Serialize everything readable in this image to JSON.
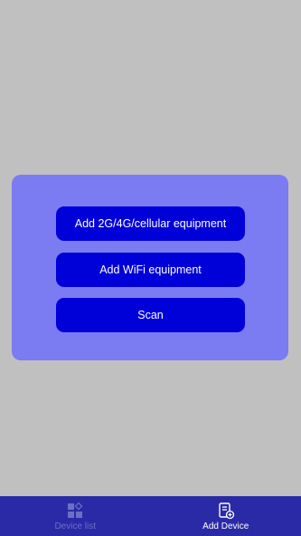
{
  "dialog": {
    "buttons": [
      {
        "label": "Add 2G/4G/cellular equipment"
      },
      {
        "label": "Add WiFi equipment"
      },
      {
        "label": "Scan"
      }
    ]
  },
  "tabbar": {
    "tabs": [
      {
        "label": "Device list",
        "icon": "grid-icon",
        "active": false
      },
      {
        "label": "Add Device",
        "icon": "add-device-icon",
        "active": true
      }
    ]
  },
  "colors": {
    "background": "#c0c0c0",
    "dialog": "#7b7bf2",
    "button": "#0000d8",
    "tabbar": "#2a2aa6",
    "tab_inactive": "#6e6ec4",
    "tab_active": "#ffffff"
  }
}
